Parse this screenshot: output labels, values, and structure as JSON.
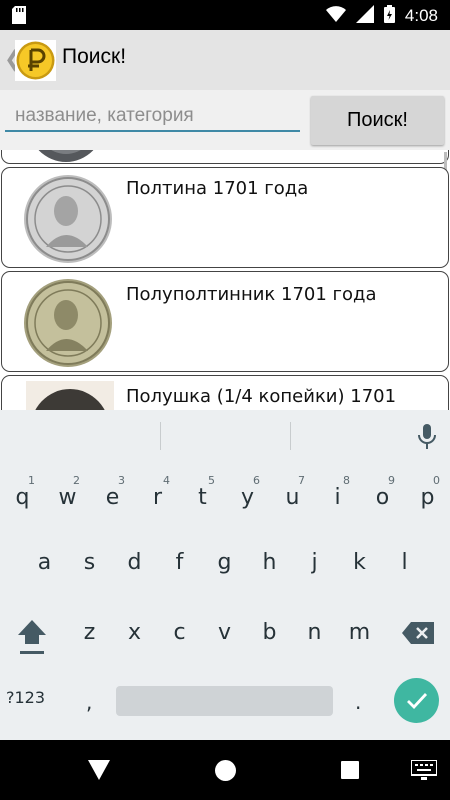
{
  "status_bar": {
    "time": "4:08"
  },
  "app_bar": {
    "back_glyph": "❮",
    "title": "Поиск!"
  },
  "search": {
    "placeholder": "название, категория",
    "value": "",
    "button_label": "Поиск!"
  },
  "list": {
    "items": [
      {
        "title": "Полтина 1701 года"
      },
      {
        "title": "Полуполтинник 1701 года"
      },
      {
        "title": "Полушка (1/4 копейки) 1701"
      }
    ]
  },
  "keyboard": {
    "row1": [
      {
        "ch": "q",
        "hint": "1"
      },
      {
        "ch": "w",
        "hint": "2"
      },
      {
        "ch": "e",
        "hint": "3"
      },
      {
        "ch": "r",
        "hint": "4"
      },
      {
        "ch": "t",
        "hint": "5"
      },
      {
        "ch": "y",
        "hint": "6"
      },
      {
        "ch": "u",
        "hint": "7"
      },
      {
        "ch": "i",
        "hint": "8"
      },
      {
        "ch": "o",
        "hint": "9"
      },
      {
        "ch": "p",
        "hint": "0"
      }
    ],
    "row2": [
      "a",
      "s",
      "d",
      "f",
      "g",
      "h",
      "j",
      "k",
      "l"
    ],
    "row3": [
      "z",
      "x",
      "c",
      "v",
      "b",
      "n",
      "m"
    ],
    "symbols_label": "?123",
    "comma": ",",
    "period": "."
  },
  "colors": {
    "accent": "#3f89a6",
    "enter": "#3fb7a1",
    "app_bar": "#e4e4e4"
  },
  "icons": [
    "sd-card-icon",
    "wifi-icon",
    "signal-icon",
    "battery-icon",
    "ruble-coin-logo",
    "mic-icon",
    "shift-icon",
    "backspace-icon",
    "check-icon",
    "nav-back-icon",
    "nav-home-icon",
    "nav-recents-icon",
    "keyboard-switch-icon"
  ]
}
